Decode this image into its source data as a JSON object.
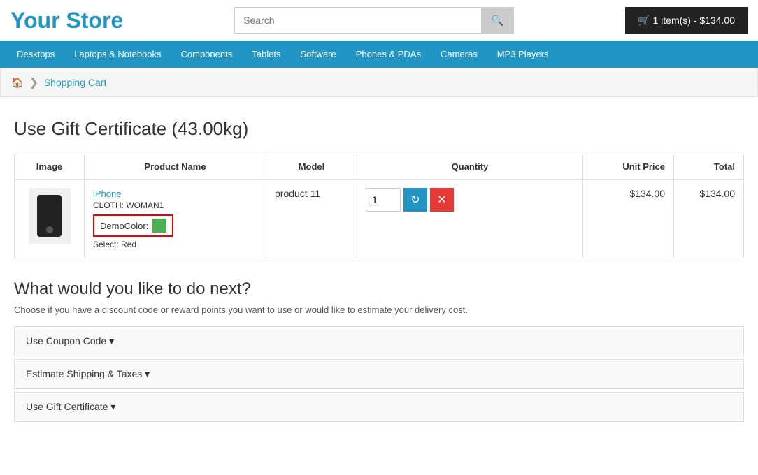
{
  "header": {
    "store_title": "Your Store",
    "search_placeholder": "Search",
    "search_btn_icon": "search-icon",
    "cart_label": "1 item(s) - $134.00"
  },
  "navbar": {
    "items": [
      {
        "label": "Desktops"
      },
      {
        "label": "Laptops & Notebooks"
      },
      {
        "label": "Components"
      },
      {
        "label": "Tablets"
      },
      {
        "label": "Software"
      },
      {
        "label": "Phones & PDAs"
      },
      {
        "label": "Cameras"
      },
      {
        "label": "MP3 Players"
      }
    ]
  },
  "breadcrumb": {
    "home_icon": "home-icon",
    "separator": "❯",
    "current": "Shopping Cart"
  },
  "page": {
    "title": "Use Gift Certificate  (43.00kg)"
  },
  "cart_table": {
    "headers": {
      "image": "Image",
      "product_name": "Product Name",
      "model": "Model",
      "quantity": "Quantity",
      "unit_price": "Unit Price",
      "total": "Total"
    },
    "rows": [
      {
        "product_name": "iPhone",
        "product_cloth": "CLOTH: WOMAN1",
        "demo_color_label": "DemoColor:",
        "select_label": "Select: Red",
        "model": "product 11",
        "quantity": "1",
        "unit_price": "$134.00",
        "total": "$134.00"
      }
    ]
  },
  "what_next": {
    "title": "What would you like to do next?",
    "description": "Choose if you have a discount code or reward points you want to use or would like to estimate your delivery cost.",
    "accordion": [
      {
        "label": "Use Coupon Code ▾"
      },
      {
        "label": "Estimate Shipping & Taxes ▾"
      },
      {
        "label": "Use Gift Certificate ▾"
      }
    ]
  }
}
